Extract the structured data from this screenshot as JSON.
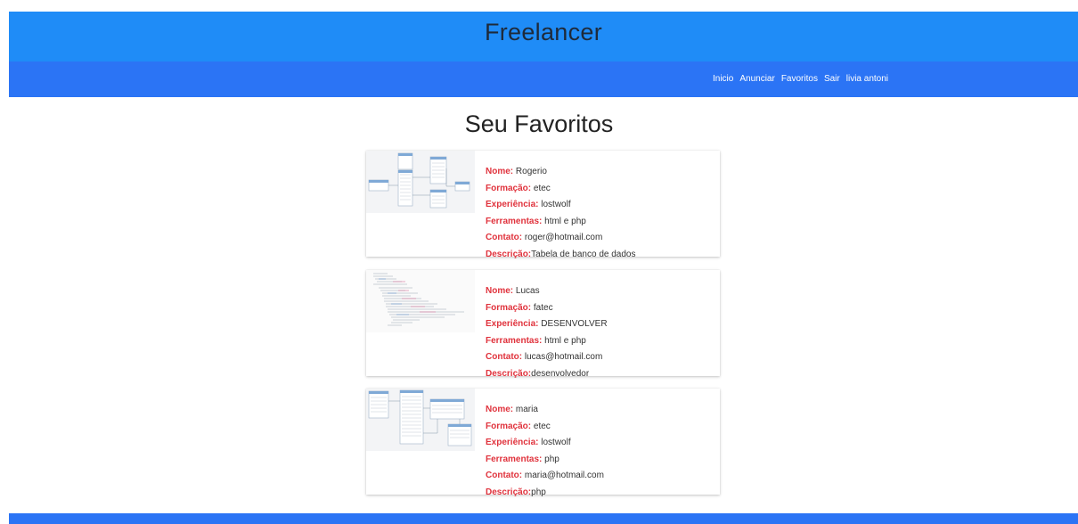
{
  "header": {
    "brand": "Freelancer"
  },
  "nav": {
    "items": [
      {
        "label": "Inicio"
      },
      {
        "label": "Anunciar"
      },
      {
        "label": "Favoritos"
      },
      {
        "label": "Sair"
      },
      {
        "label": "livia antoni"
      }
    ]
  },
  "page": {
    "title": "Seu Favoritos"
  },
  "labels": {
    "nome": "Nome:",
    "formacao": "Formação:",
    "experiencia": "Experiência:",
    "ferramentas": "Ferramentas:",
    "contato": "Contato:",
    "descricao": "Descrição:"
  },
  "cards": [
    {
      "thumbnail": "database-diagram-image",
      "nome": "Rogerio",
      "formacao": "etec",
      "experiencia": "lostwolf",
      "ferramentas": "html e php",
      "contato": "roger@hotmail.com",
      "descricao": "Tabela de banco de dados"
    },
    {
      "thumbnail": "code-screenshot-image",
      "nome": "Lucas",
      "formacao": "fatec",
      "experiencia": "DESENVOLVER",
      "ferramentas": "html e php",
      "contato": "lucas@hotmail.com",
      "descricao": "desenvolvedor"
    },
    {
      "thumbnail": "database-diagram-image",
      "nome": "maria",
      "formacao": "etec",
      "experiencia": "lostwolf",
      "ferramentas": "php",
      "contato": "maria@hotmail.com",
      "descricao": "php"
    }
  ],
  "colors": {
    "title_bar": "#1f8cf7",
    "nav_bar": "#2b74f5",
    "label_red": "#e0323c"
  }
}
